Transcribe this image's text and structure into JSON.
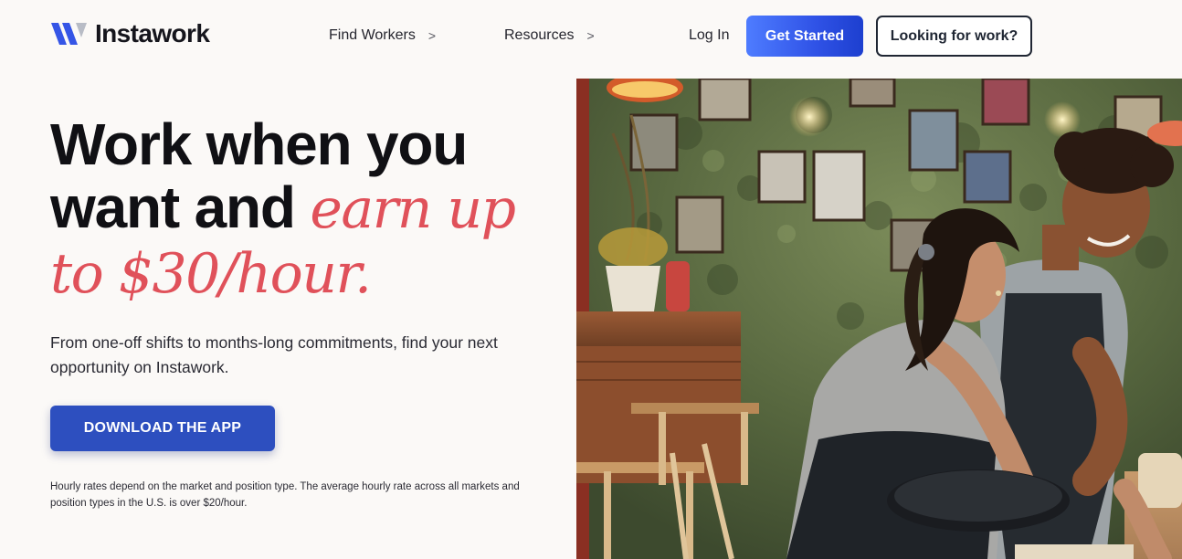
{
  "brand": {
    "name": "Instawork",
    "logo_colors": [
      "#3555e6",
      "#b8bcc6"
    ]
  },
  "nav": {
    "find_workers": "Find Workers",
    "resources": "Resources",
    "chevron": ">",
    "login": "Log In",
    "get_started": "Get Started",
    "looking_for_work": "Looking for work?"
  },
  "hero": {
    "headline_line1": "Work when you",
    "headline_line2_plain": "want and",
    "headline_line2_accent": "earn up",
    "headline_line3_accent": "to $30/hour.",
    "subtext": "From one-off shifts to months-long commitments, find your next opportunity on Instawork.",
    "download_button": "DOWNLOAD THE APP",
    "disclaimer": "Hourly rates depend on the market and position type. The average hourly rate across all markets and position types in the U.S. is over $20/hour."
  },
  "colors": {
    "accent_red": "#e0515a",
    "primary_blue": "#2d4fbf",
    "get_started_blue": "#2f52e6",
    "page_bg": "#fbf9f7"
  },
  "photo": {
    "subject": "two restaurant workers in aprons setting a table"
  }
}
